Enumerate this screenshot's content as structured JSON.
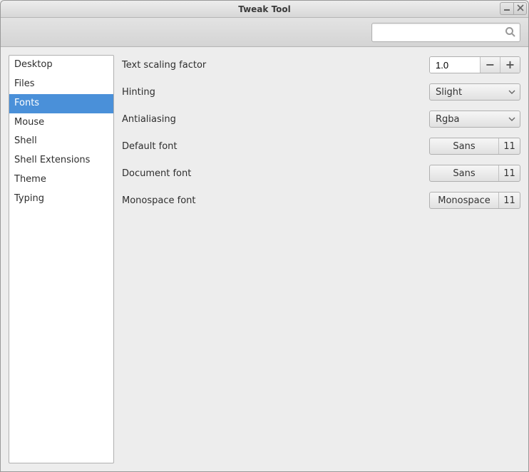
{
  "window": {
    "title": "Tweak Tool"
  },
  "toolbar": {
    "search_value": ""
  },
  "sidebar": {
    "items": [
      {
        "label": "Desktop",
        "selected": false
      },
      {
        "label": "Files",
        "selected": false
      },
      {
        "label": "Fonts",
        "selected": true
      },
      {
        "label": "Mouse",
        "selected": false
      },
      {
        "label": "Shell",
        "selected": false
      },
      {
        "label": "Shell Extensions",
        "selected": false
      },
      {
        "label": "Theme",
        "selected": false
      },
      {
        "label": "Typing",
        "selected": false
      }
    ]
  },
  "settings": {
    "scaling": {
      "label": "Text scaling factor",
      "value": "1.0"
    },
    "hinting": {
      "label": "Hinting",
      "value": "Slight"
    },
    "antialiasing": {
      "label": "Antialiasing",
      "value": "Rgba"
    },
    "default_font": {
      "label": "Default font",
      "family": "Sans",
      "size": "11"
    },
    "document_font": {
      "label": "Document font",
      "family": "Sans",
      "size": "11"
    },
    "monospace_font": {
      "label": "Monospace font",
      "family": "Monospace",
      "size": "11"
    }
  }
}
